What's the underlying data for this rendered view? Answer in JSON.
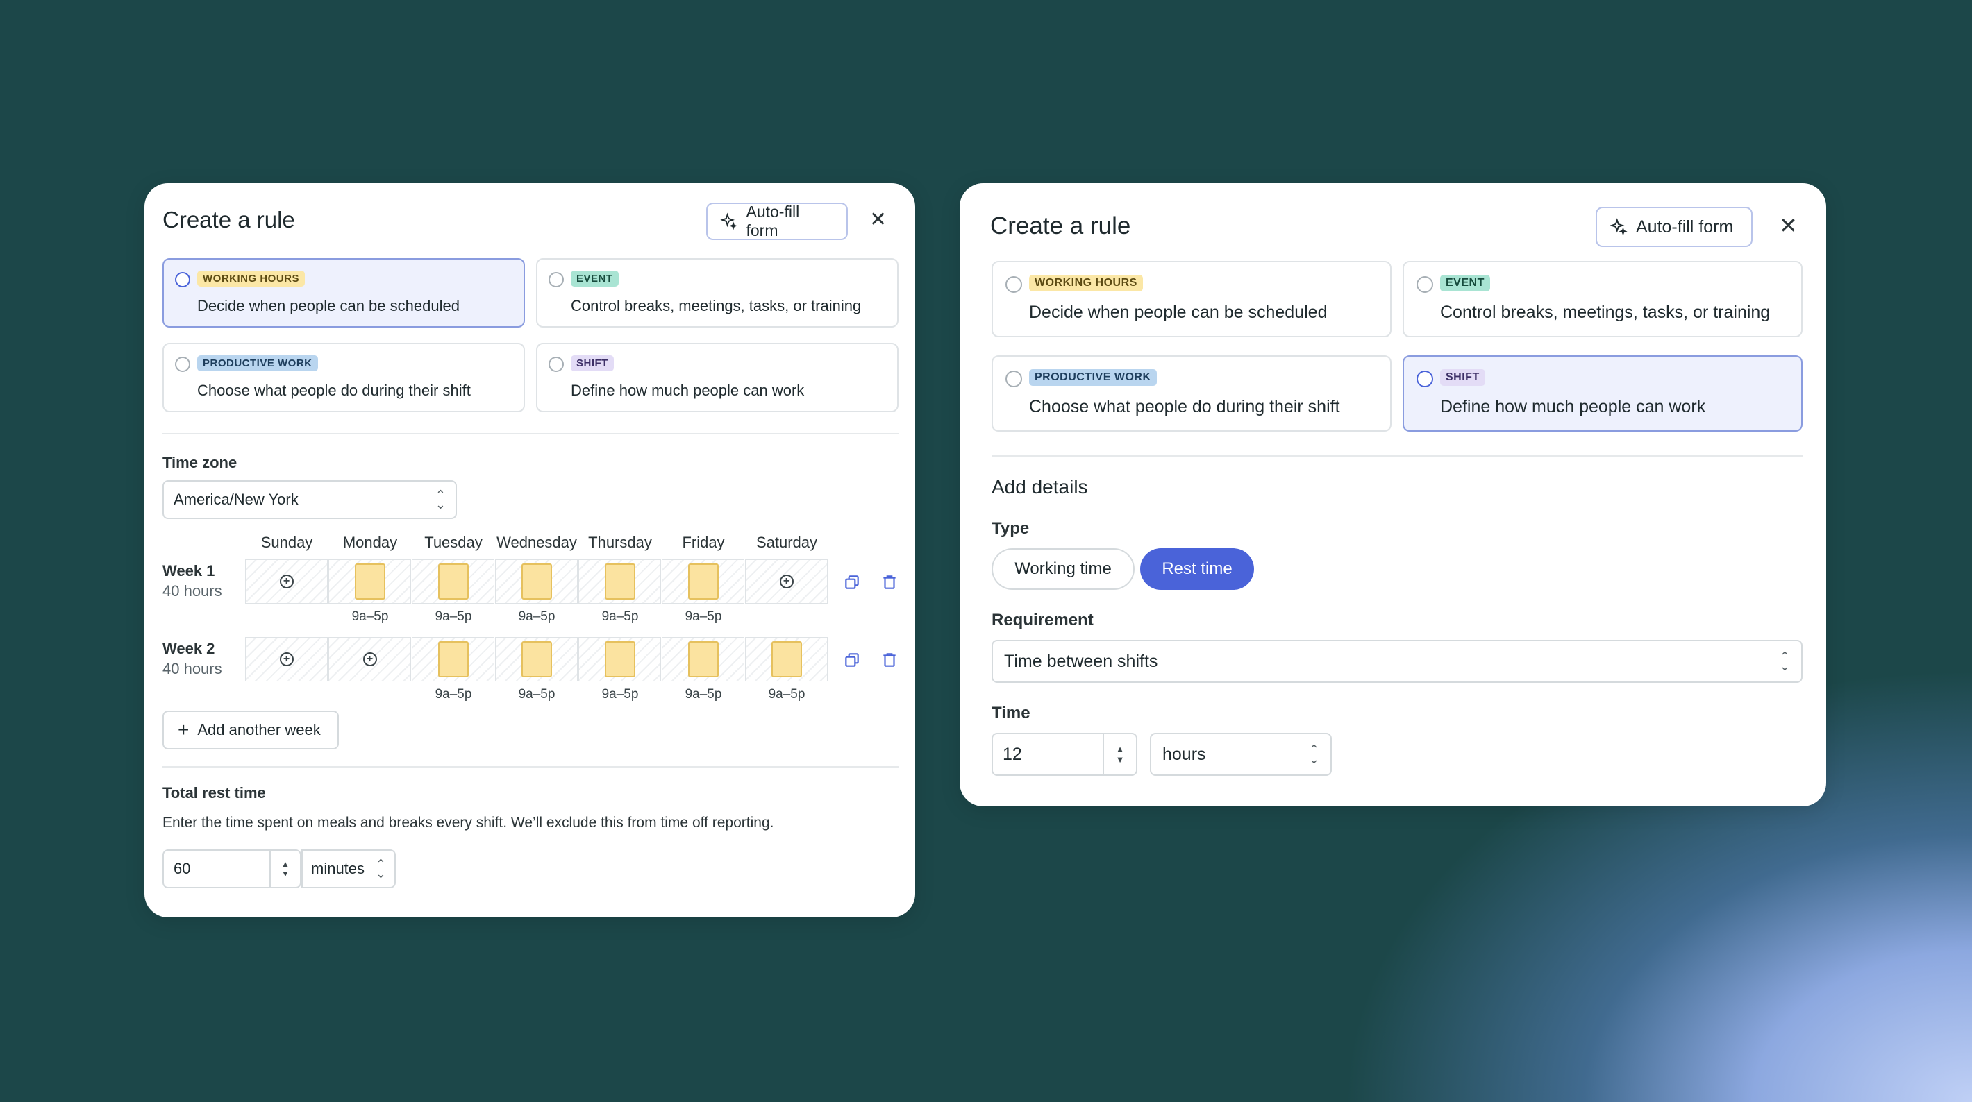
{
  "left": {
    "title": "Create a rule",
    "autofill_label": "Auto-fill form",
    "options": [
      {
        "badge": "WORKING HOURS",
        "desc": "Decide when people can be scheduled",
        "selected": true
      },
      {
        "badge": "EVENT",
        "desc": "Control breaks, meetings, tasks, or training",
        "selected": false
      },
      {
        "badge": "PRODUCTIVE WORK",
        "desc": "Choose what people do during their shift",
        "selected": false
      },
      {
        "badge": "SHIFT",
        "desc": "Define how much people can work",
        "selected": false
      }
    ],
    "timezone_label": "Time zone",
    "timezone_value": "America/New York",
    "days": [
      "Sunday",
      "Monday",
      "Tuesday",
      "Wednesday",
      "Thursday",
      "Friday",
      "Saturday"
    ],
    "weeks": [
      {
        "label": "Week 1",
        "hours": "40 hours",
        "slots": [
          "",
          "9a–5p",
          "9a–5p",
          "9a–5p",
          "9a–5p",
          "9a–5p",
          ""
        ]
      },
      {
        "label": "Week 2",
        "hours": "40 hours",
        "slots": [
          "",
          "",
          "9a–5p",
          "9a–5p",
          "9a–5p",
          "9a–5p",
          "9a–5p"
        ]
      }
    ],
    "add_week_label": "Add another week",
    "rest_label": "Total rest time",
    "rest_desc": "Enter the time spent on meals and breaks every shift. We’ll exclude this from time off reporting.",
    "rest_value": "60",
    "rest_unit": "minutes"
  },
  "right": {
    "title": "Create a rule",
    "autofill_label": "Auto-fill form",
    "options": [
      {
        "badge": "WORKING HOURS",
        "desc": "Decide when people can be scheduled",
        "selected": false
      },
      {
        "badge": "EVENT",
        "desc": "Control breaks, meetings, tasks, or training",
        "selected": false
      },
      {
        "badge": "PRODUCTIVE WORK",
        "desc": "Choose what people do during their shift",
        "selected": false
      },
      {
        "badge": "SHIFT",
        "desc": "Define how much people can work",
        "selected": true
      }
    ],
    "details_heading": "Add details",
    "type_label": "Type",
    "type_options": [
      "Working time",
      "Rest time"
    ],
    "requirement_label": "Requirement",
    "requirement_value": "Time between shifts",
    "time_label": "Time",
    "time_value": "12",
    "time_unit": "hours"
  },
  "colors": {
    "background": "#1c4749",
    "accent": "#4a63d9",
    "selected_bg": "#eef1fd",
    "shift_block": "#fbe3a0"
  }
}
